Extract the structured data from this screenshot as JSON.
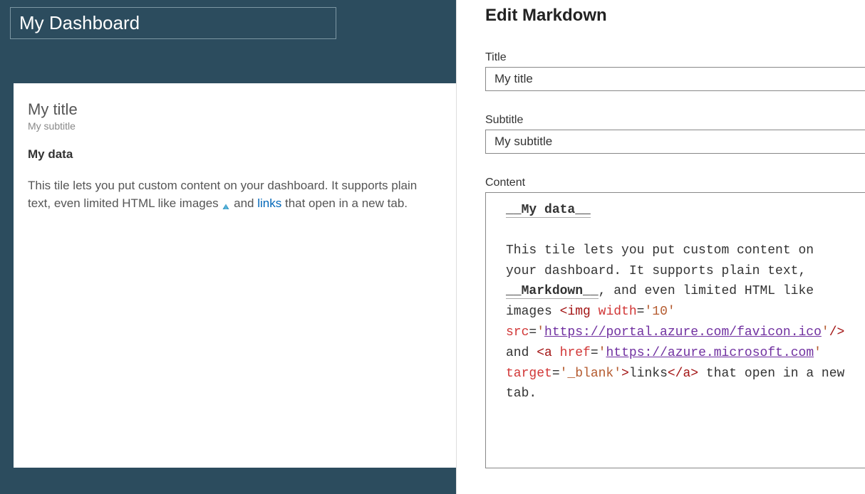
{
  "dashboard": {
    "name": "My Dashboard"
  },
  "tile": {
    "title": "My title",
    "subtitle": "My subtitle",
    "data_heading": "My data",
    "body_prefix": "This tile lets you put custom content on your dashboard. It supports plain text, even limited HTML like images ",
    "body_mid": " and ",
    "link_text": "links",
    "body_suffix": " that open in a new tab."
  },
  "panel": {
    "heading": "Edit Markdown",
    "title_label": "Title",
    "title_value": "My title",
    "subtitle_label": "Subtitle",
    "subtitle_value": "My subtitle",
    "content_label": "Content",
    "content_md": {
      "line1_underscore_open": "__",
      "line1_text": "My data",
      "line1_underscore_close": "__",
      "para_prefix": "This tile lets you put custom content on your dashboard. It supports plain text, ",
      "bold_open": "__",
      "bold_text": "Markdown",
      "bold_close": "__",
      "after_bold": ", and even limited HTML like images ",
      "img_open": "<img",
      "img_width_attr": " width",
      "img_eq": "=",
      "img_width_val": "'10'",
      "img_src_attr": "src",
      "img_src_eq": "=",
      "img_src_q1": "'",
      "img_src_url": "https://portal.azure.com/favicon.ico",
      "img_src_q2": "'",
      "img_close": "/>",
      "and_text": " and ",
      "a_open": "<a",
      "a_href_attr": "href",
      "a_href_eq": "=",
      "a_href_q1": "'",
      "a_href_url": "https://azure.microsoft.com",
      "a_href_q2": "'",
      "a_target_attr": "target",
      "a_target_eq": "=",
      "a_target_val": "'_blank'",
      "a_gt": ">",
      "a_text": "links",
      "a_close": "</a>",
      "tail": " that open in a new tab."
    }
  }
}
